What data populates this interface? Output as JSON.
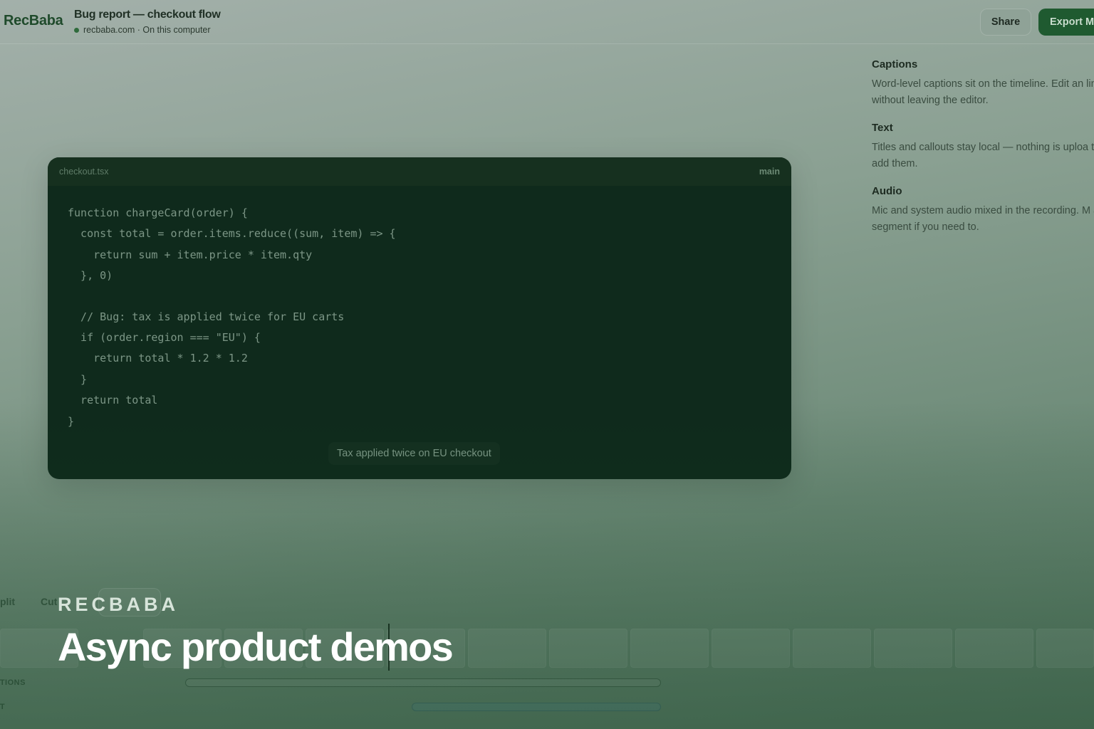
{
  "header": {
    "brand": "RecBaba",
    "title": "Bug report — checkout flow",
    "meta": "recbaba.com · On this computer",
    "share_label": "Share",
    "export_label": "Export M"
  },
  "panel": {
    "sections": [
      {
        "heading": "Captions",
        "body": "Word-level captions sit on the timeline. Edit an line without leaving the editor."
      },
      {
        "heading": "Text",
        "body": "Titles and callouts stay local — nothing is uploa to add them."
      },
      {
        "heading": "Audio",
        "body": "Mic and system audio mixed in the recording. M a segment if you need to."
      }
    ]
  },
  "editor": {
    "filename": "checkout.tsx",
    "branch": "main",
    "code_lines": [
      "function chargeCard(order) {",
      "  const total = order.items.reduce((sum, item) => {",
      "    return sum + item.price * item.qty",
      "  }, 0)",
      "",
      "  // Bug: tax is applied twice for EU carts",
      "  if (order.region === \"EU\") {",
      "    return total * 1.2 * 1.2",
      "  }",
      "  return total",
      "}"
    ],
    "caption": "Tax applied twice on EU checkout"
  },
  "timeline": {
    "tools": [
      "plit",
      "Cut"
    ],
    "tracks": [
      {
        "label": "PTIONS",
        "kind": "captions"
      },
      {
        "label": "XT",
        "kind": "text"
      }
    ]
  },
  "overlay": {
    "eyebrow": "RECBABA",
    "headline": "Async product demos"
  },
  "colors": {
    "accent": "#1f5a30",
    "card_bg": "#0f2a1c",
    "headline": "#ffffff"
  }
}
